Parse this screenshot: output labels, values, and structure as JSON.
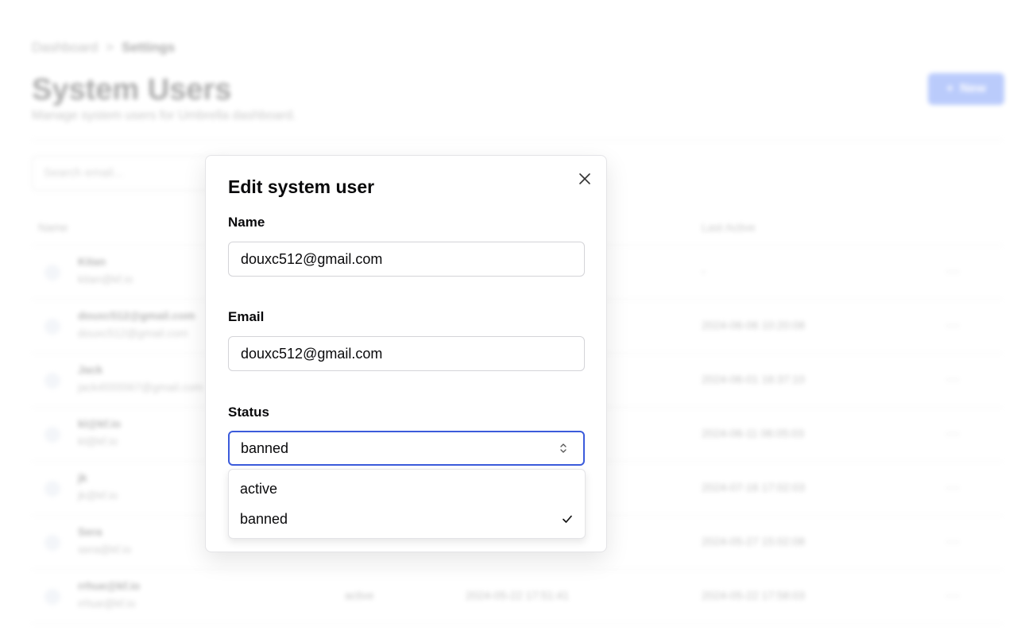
{
  "background": {
    "breadcrumb": {
      "root": "Dashboard",
      "separator": ">",
      "current": "Settings"
    },
    "title": "System Users",
    "subtitle": "Manage system users for Umbrella dashboard.",
    "new_button": {
      "icon": "plus-icon",
      "label": "New"
    },
    "search_placeholder": "Search email...",
    "table": {
      "headers": {
        "name": "Name",
        "last_active": "Last Active"
      },
      "rows": [
        {
          "name": "Kitan",
          "email": "kitan@kf.io",
          "status": "",
          "created": "",
          "last_active": "-",
          "more": "···"
        },
        {
          "name": "douxc512@gmail.com",
          "email": "douxc512@gmail.com",
          "status": "",
          "created": "",
          "last_active": "2024-06-06 10:20:08",
          "more": "···"
        },
        {
          "name": "Jack",
          "email": "jack4555567@gmail.com",
          "status": "",
          "created": "",
          "last_active": "2024-06-01 16:37:10",
          "more": "···"
        },
        {
          "name": "kl@kf.io",
          "email": "kl@kf.io",
          "status": "",
          "created": "",
          "last_active": "2024-06-11 06:05:03",
          "more": "···"
        },
        {
          "name": "jk",
          "email": "jk@kf.io",
          "status": "",
          "created": "",
          "last_active": "2024-07-16 17:02:03",
          "more": "···"
        },
        {
          "name": "Sera",
          "email": "sera@kf.io",
          "status": "",
          "created": "",
          "last_active": "2024-05-27 15:02:08",
          "more": "···"
        },
        {
          "name": "rrhue@kf.io",
          "email": "rrhue@kf.io",
          "status": "active",
          "created": "2024-05-22 17:51:41",
          "last_active": "2024-05-22 17:58:03",
          "more": "···"
        }
      ]
    }
  },
  "dialog": {
    "title": "Edit system user",
    "close_icon": "close-icon",
    "name_label": "Name",
    "name_value": "douxc512@gmail.com",
    "email_label": "Email",
    "email_value": "douxc512@gmail.com",
    "status_label": "Status",
    "status_value": "banned",
    "status_options": [
      {
        "label": "active",
        "selected": false
      },
      {
        "label": "banned",
        "selected": true
      }
    ]
  }
}
